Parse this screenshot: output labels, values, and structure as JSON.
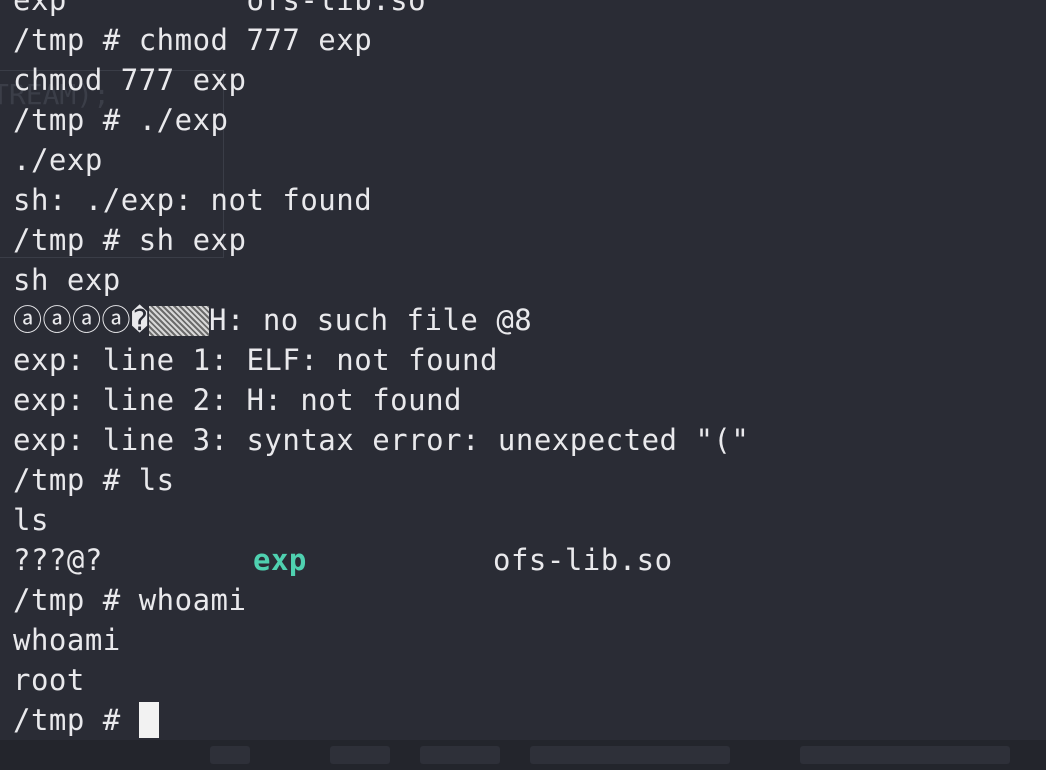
{
  "terminal": {
    "prompt": "/tmp # ",
    "lines": {
      "l0": "exp          ofs-lib.so",
      "l1": "/tmp # chmod 777 exp",
      "l2": "chmod 777 exp",
      "l3": "/tmp # ./exp",
      "l4": "./exp",
      "l5": "sh: ./exp: not found",
      "l6": "/tmp # sh exp",
      "l7": "sh exp",
      "l8_prefix": "ⓐⓐⓐⓐ�",
      "l8_suffix": "H: no such file @8",
      "l9": "exp: line 1: ELF: not found",
      "l10": "exp: line 2: H: not found",
      "l11": "exp: line 3: syntax error: unexpected \"(\"",
      "l12": "/tmp # ls",
      "l13": "ls",
      "l14_c1": "???@?",
      "l14_c2": "exp",
      "l14_c3": "ofs-lib.so",
      "l15": "/tmp # whoami",
      "l16": "whoami",
      "l17": "root"
    }
  },
  "ghost_text": "TREAM);",
  "colors": {
    "background": "#2a2c35",
    "foreground": "#e9e9ec",
    "executable": "#4fd1b0",
    "cursor": "#f2f2f2"
  }
}
